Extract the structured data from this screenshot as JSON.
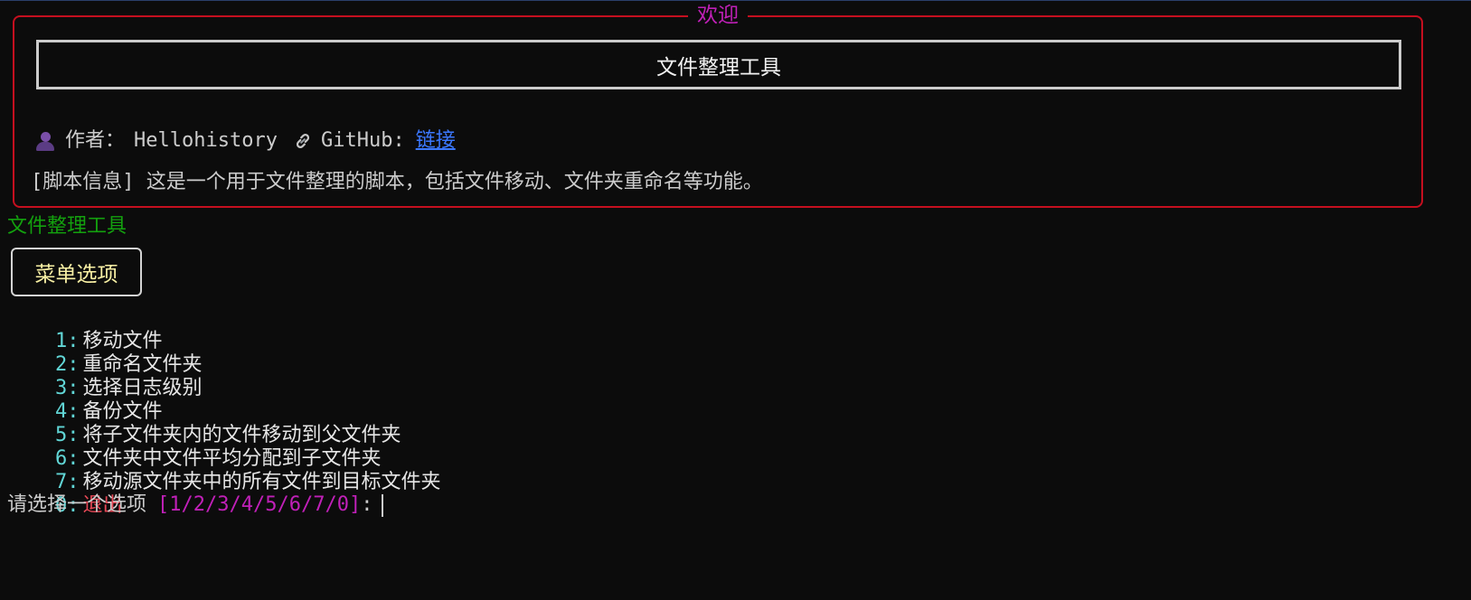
{
  "panel": {
    "title": "欢迎",
    "app_title": "文件整理工具",
    "author_label": "作者：",
    "author_name": "Hellohistory",
    "github_label": "GitHub:",
    "github_link_text": "链接",
    "script_info": "[脚本信息] 这是一个用于文件整理的脚本，包括文件移动、文件夹重命名等功能。",
    "border_color": "#c50f1f"
  },
  "section_title": "文件整理工具",
  "menu": {
    "header": "菜单选项",
    "options": [
      {
        "key": "1:",
        "label": "移动文件"
      },
      {
        "key": "2:",
        "label": "重命名文件夹"
      },
      {
        "key": "3:",
        "label": "选择日志级别"
      },
      {
        "key": "4:",
        "label": "备份文件"
      },
      {
        "key": "5:",
        "label": "将子文件夹内的文件移动到父文件夹"
      },
      {
        "key": "6:",
        "label": "文件夹中文件平均分配到子文件夹"
      },
      {
        "key": "7:",
        "label": "移动源文件夹中的所有文件到目标文件夹"
      },
      {
        "key": "0:",
        "label": "退出"
      }
    ]
  },
  "prompt": {
    "text": "请选择一个选项",
    "choices": "[1/2/3/4/5/6/7/0]",
    "colon": ":"
  },
  "icons": {
    "author": "person-icon",
    "link": "link-icon"
  },
  "colors": {
    "background": "#0c0c0c",
    "panel_title": "#c020b8",
    "section_title": "#13a10e",
    "menu_header": "#f9f1a5",
    "option_key": "#61d6d6",
    "exit": "#e74856",
    "link": "#3b78ff"
  }
}
